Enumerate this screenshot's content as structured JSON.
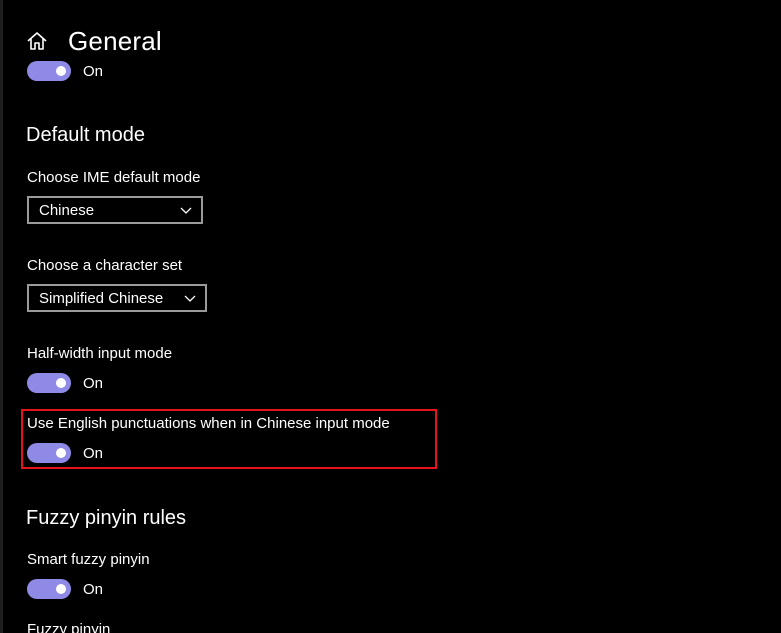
{
  "header": {
    "title": "General",
    "home_icon": "home-icon"
  },
  "top_toggle": {
    "state": "On"
  },
  "default_mode": {
    "section_title": "Default mode",
    "ime_mode": {
      "label": "Choose IME default mode",
      "value": "Chinese"
    },
    "character_set": {
      "label": "Choose a character set",
      "value": "Simplified Chinese"
    },
    "half_width": {
      "label": "Half-width input mode",
      "state": "On"
    },
    "english_punctuation": {
      "label": "Use English punctuations when in Chinese input mode",
      "state": "On"
    }
  },
  "fuzzy_pinyin": {
    "section_title": "Fuzzy pinyin rules",
    "smart_fuzzy": {
      "label": "Smart fuzzy pinyin",
      "state": "On"
    },
    "fuzzy": {
      "label": "Fuzzy pinyin"
    }
  },
  "colors": {
    "background": "#000000",
    "toggle_on": "#8f8ae6",
    "highlight": "#e8121b",
    "dropdown_border": "#9a9a9a"
  }
}
